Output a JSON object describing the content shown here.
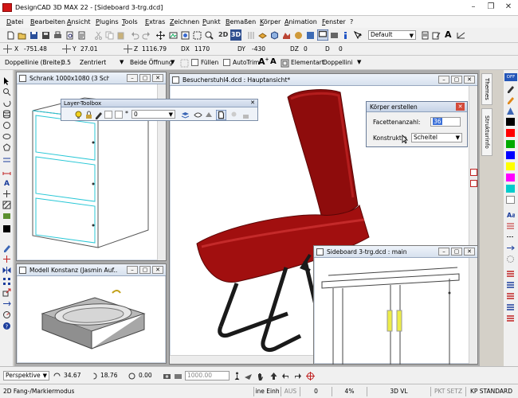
{
  "titlebar": {
    "title": "DesignCAD 3D MAX 22 - [Sideboard 3-trg.dcd]",
    "minimize": "–",
    "restore": "❐",
    "close": "✕"
  },
  "menu": [
    "Datei",
    "Bearbeiten",
    "Ansicht",
    "Plugins",
    "Tools",
    "Extras",
    "Zeichnen",
    "Punkt",
    "Bemaßen",
    "Körper",
    "Animation",
    "Fenster",
    "?"
  ],
  "toolbar1": {
    "tool_3d": "3D",
    "style_combo": "Default",
    "text_tool": "A"
  },
  "coords": {
    "x_label": "X",
    "x_value": "-751.48",
    "y_label": "Y",
    "y_value": "27.01",
    "z_label": "Z",
    "z_value": "1116.79",
    "dx_label": "DX",
    "dx_value": "1170",
    "dy_label": "DY",
    "dy_value": "-430",
    "dz_label": "DZ",
    "dz_value": "0",
    "d_label": "D",
    "d_value": "0"
  },
  "lineopts": {
    "width_label": "Doppellinie (Breite):",
    "width_value": "0.5",
    "align_value": "Zentriert",
    "opening_value": "Beide Öffnung",
    "fill_label": "Füllen",
    "autotrim_label": "AutoTrim",
    "elementart_label": "Elementart:",
    "elementart_value": "Doppellini"
  },
  "windows": {
    "schrank": "Schrank 1000x1080 (3 Sch).dc...",
    "besucher": "Besucherstuhl4.dcd : Hauptansicht*",
    "modell": "Modell Konstanz (Jasmin Auf...",
    "sideboard": "Sideboard 3-trg.dcd : main"
  },
  "layer_toolbox": {
    "title": "Layer-Toolbox",
    "layer_value": "0",
    "close": "✕"
  },
  "koerper_dialog": {
    "title": "Körper erstellen",
    "facetten_label": "Facettenanzahl:",
    "facetten_value": "36",
    "konstruktion_label": "Konstruktio",
    "konstruktion_value": "Scheitel",
    "close": "✕"
  },
  "side_tabs": {
    "themes": "Themes",
    "strukturinfo": "Strukturinfo"
  },
  "right_colors": [
    "#000000",
    "#ff0000",
    "#00aa00",
    "#0000ff",
    "#ffff00",
    "#ff00ff",
    "#00cccc",
    "#ffffff"
  ],
  "bottombar": {
    "view_value": "Perspektive",
    "angle1": "34.67",
    "angle2": "18.76",
    "angle3": "0.00",
    "dist_placeholder": "1000.00"
  },
  "statusbar": {
    "mode": "2D Fang-/Markiermodus",
    "unit": "ine Einh",
    "aus": "AUS",
    "val0": "0",
    "percent": "4%",
    "view3d": "3D VL",
    "pkt_setz": "PKT SETZ",
    "kp_standard": "KP STANDARD"
  }
}
